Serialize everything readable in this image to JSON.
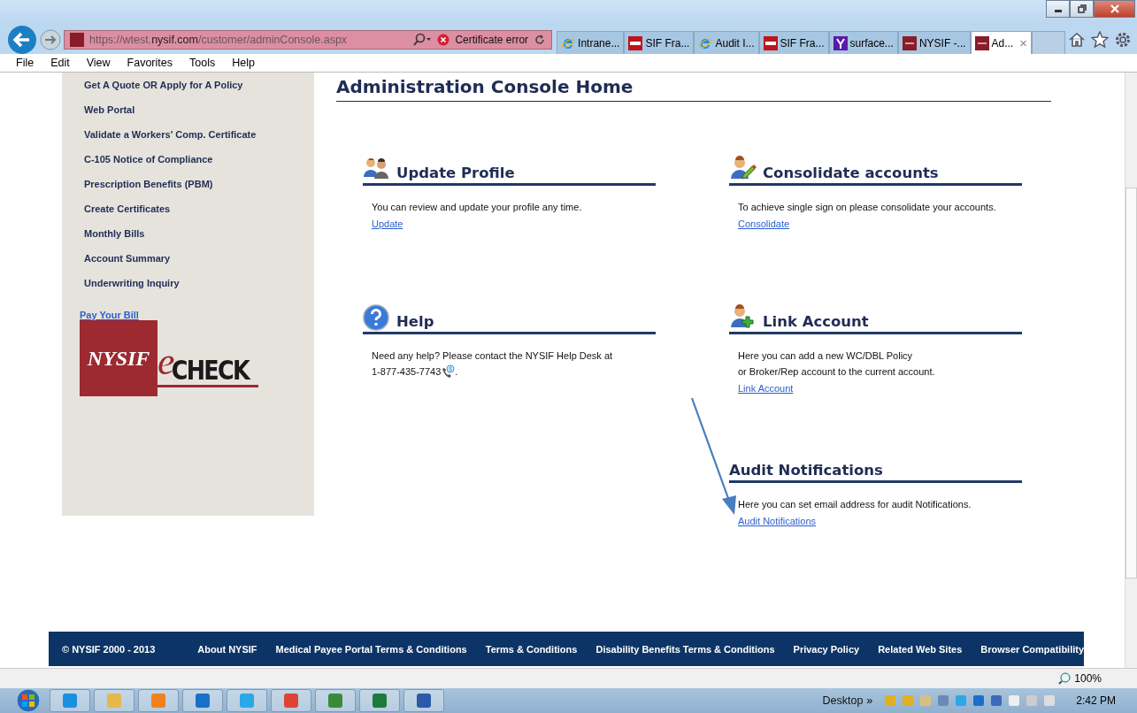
{
  "browser": {
    "address": {
      "prefix": "https://wtest.",
      "domain": "nysif.com",
      "path": "/customer/adminConsole.aspx"
    },
    "cert_error": "Certificate error",
    "tabs": [
      {
        "label": "Intrane...",
        "selected": false,
        "kind": "ie"
      },
      {
        "label": "SIF Fra...",
        "selected": false,
        "kind": "nysif"
      },
      {
        "label": "Audit I...",
        "selected": false,
        "kind": "ie"
      },
      {
        "label": "SIF Fra...",
        "selected": false,
        "kind": "nysif"
      },
      {
        "label": "surface...",
        "selected": false,
        "kind": "yahoo"
      },
      {
        "label": "NYSIF -...",
        "selected": false,
        "kind": "seal"
      },
      {
        "label": "Ad...",
        "selected": true,
        "kind": "seal"
      }
    ],
    "close_tab": "×"
  },
  "menu": [
    "File",
    "Edit",
    "View",
    "Favorites",
    "Tools",
    "Help"
  ],
  "sidebar": {
    "items": [
      "Get A Quote OR Apply for A Policy",
      "Web Portal",
      "Validate a Workers' Comp. Certificate",
      "C-105 Notice of Compliance",
      "Prescription Benefits (PBM)",
      "Create Certificates",
      "Monthly Bills",
      "Account Summary",
      "Underwriting Inquiry"
    ],
    "pay_link": "Pay Your Bill",
    "logo": {
      "brand": "NYSIF",
      "e": "e",
      "product": "CHECK"
    }
  },
  "main": {
    "title": "Administration Console Home",
    "columns": [
      [
        {
          "title": "Update Profile",
          "kind": "profile",
          "lines": [
            "You can review and update your profile any time."
          ],
          "link": "Update"
        },
        {
          "title": "Help",
          "kind": "help",
          "lines": [
            "Need any help? Please contact the NYSIF Help Desk at"
          ],
          "phone": "1-877-435-7743",
          "phone_end": "."
        }
      ],
      [
        {
          "title": "Consolidate accounts",
          "kind": "consolidate",
          "lines": [
            "To achieve single sign on please consolidate your accounts."
          ],
          "link": "Consolidate"
        },
        {
          "title": "Link Account",
          "kind": "link",
          "lines": [
            "Here you can add a new WC/DBL Policy",
            "or Broker/Rep account to the current account."
          ],
          "link": "Link Account"
        },
        {
          "title": "Audit Notifications",
          "kind": "plain",
          "lines": [
            "Here you can set email address for audit Notifications."
          ],
          "link": "Audit Notifications"
        }
      ]
    ]
  },
  "footer": {
    "copyright": "© NYSIF 2000 - 2013",
    "links": [
      "About NYSIF",
      "Medical Payee Portal Terms & Conditions",
      "Terms & Conditions",
      "Disability Benefits Terms & Conditions",
      "Privacy Policy",
      "Related Web Sites",
      "Browser Compatibility"
    ]
  },
  "zoom": "100%",
  "taskbar": {
    "apps": [
      {
        "kind": "ie"
      },
      {
        "kind": "folder"
      },
      {
        "kind": "media"
      },
      {
        "kind": "outlook"
      },
      {
        "kind": "skype"
      },
      {
        "kind": "chrome"
      },
      {
        "kind": "project"
      },
      {
        "kind": "excel"
      },
      {
        "kind": "word"
      }
    ],
    "desktop": "Desktop",
    "more": "»",
    "time": "2:42 PM"
  }
}
